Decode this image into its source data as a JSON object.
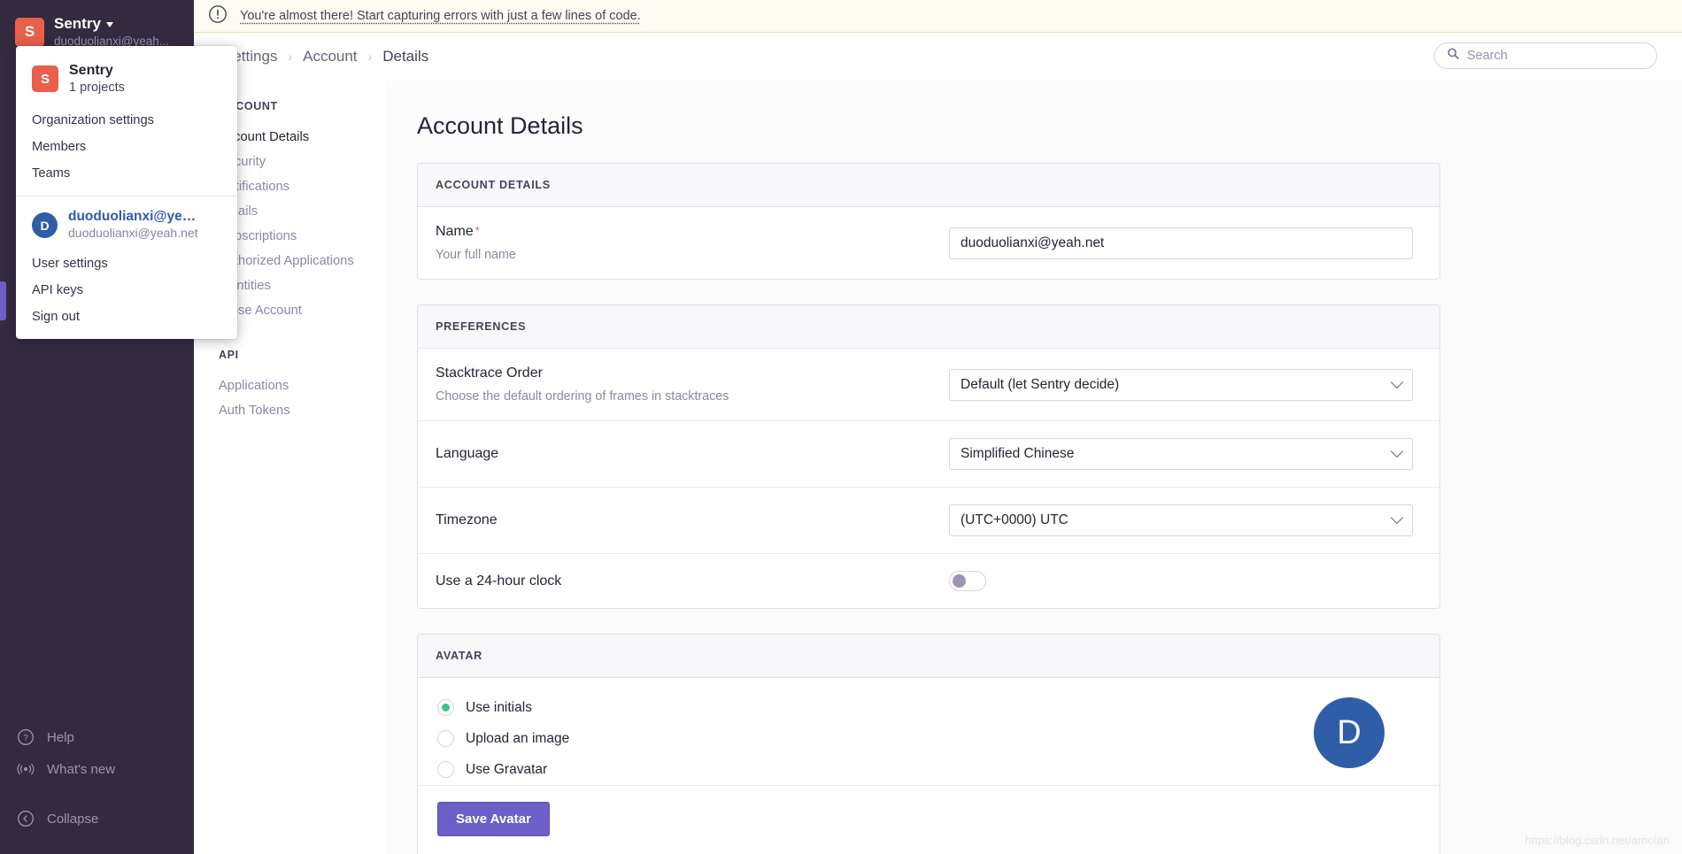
{
  "sidebar": {
    "org_initial": "S",
    "org_name": "Sentry",
    "org_email": "duoduolianxi@yeah...",
    "bottom_items": [
      {
        "label": "Help",
        "icon": "help-circle-icon"
      },
      {
        "label": "What's new",
        "icon": "broadcast-icon"
      },
      {
        "label": "Collapse",
        "icon": "chevron-left-circle-icon"
      }
    ]
  },
  "dropdown": {
    "org_initial": "S",
    "org_name": "Sentry",
    "org_projects": "1 projects",
    "org_items": [
      "Organization settings",
      "Members",
      "Teams"
    ],
    "user_initial": "D",
    "user_name": "duoduolianxi@yeah.n...",
    "user_email": "duoduolianxi@yeah.net",
    "user_items": [
      "User settings",
      "API keys",
      "Sign out"
    ]
  },
  "banner": {
    "text": "You're almost there! Start capturing errors with just a few lines of code.",
    "icon": "alert-circle-icon"
  },
  "breadcrumb": {
    "items": [
      "Settings",
      "Account",
      "Details"
    ],
    "separator": "›"
  },
  "search": {
    "placeholder": "Search",
    "icon": "search-icon"
  },
  "settings_nav": {
    "account_heading": "ACCOUNT",
    "account_items": [
      "Account Details",
      "Security",
      "Notifications",
      "Emails",
      "Subscriptions",
      "Authorized Applications",
      "Identities",
      "Close Account"
    ],
    "api_heading": "API",
    "api_items": [
      "Applications",
      "Auth Tokens"
    ]
  },
  "main": {
    "title": "Account Details",
    "account_panel": {
      "header": "ACCOUNT DETAILS",
      "name_label": "Name",
      "name_required_marker": "*",
      "name_help": "Your full name",
      "name_value": "duoduolianxi@yeah.net",
      "name_placeholder": "Your full name"
    },
    "preferences_panel": {
      "header": "PREFERENCES",
      "stacktrace_label": "Stacktrace Order",
      "stacktrace_help": "Choose the default ordering of frames in stacktraces",
      "stacktrace_value": "Default (let Sentry decide)",
      "language_label": "Language",
      "language_value": "Simplified Chinese",
      "timezone_label": "Timezone",
      "timezone_value": "(UTC+0000) UTC",
      "clock_label": "Use a 24-hour clock",
      "clock_on": false
    },
    "avatar_panel": {
      "header": "AVATAR",
      "options": [
        {
          "label": "Use initials",
          "selected": true
        },
        {
          "label": "Upload an image",
          "selected": false
        },
        {
          "label": "Use Gravatar",
          "selected": false
        }
      ],
      "avatar_initial": "D",
      "save_label": "Save Avatar"
    }
  },
  "watermark": "https://blog.csdn.net/arnolan",
  "colors": {
    "sidebar_bg": "#342a3f",
    "org_logo": "#e8604b",
    "accent_purple": "#6c5fc7",
    "avatar_blue": "#2f5da8",
    "radio_green": "#3fc38a",
    "banner_bg": "#fdfcf3"
  }
}
